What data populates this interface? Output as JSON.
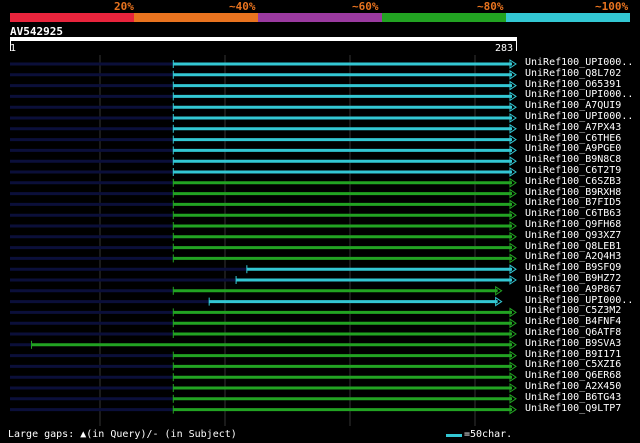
{
  "percent_bar": {
    "colors": [
      "#e8243c",
      "#e8731f",
      "#9b3aa0",
      "#22a322",
      "#33c7d3"
    ],
    "labels": [
      "20%",
      "~40%",
      "~60%",
      "~80%",
      "~100%"
    ]
  },
  "query": {
    "name": "AV542925",
    "start": "1",
    "end": "283"
  },
  "colors": {
    "high": "#33c7d3",
    "mid": "#22a322",
    "faint": "#0b0f3a"
  },
  "hits": [
    {
      "name": "UniRef100_UPI000..",
      "color": "high",
      "start": 92,
      "end": 283
    },
    {
      "name": "UniRef100_Q8L702",
      "color": "high",
      "start": 92,
      "end": 283
    },
    {
      "name": "UniRef100_O65391",
      "color": "high",
      "start": 92,
      "end": 283
    },
    {
      "name": "UniRef100_UPI000..",
      "color": "high",
      "start": 92,
      "end": 283
    },
    {
      "name": "UniRef100_A7QUI9",
      "color": "high",
      "start": 92,
      "end": 283
    },
    {
      "name": "UniRef100_UPI000..",
      "color": "high",
      "start": 92,
      "end": 283
    },
    {
      "name": "UniRef100_A7PX43",
      "color": "high",
      "start": 92,
      "end": 283
    },
    {
      "name": "UniRef100_C6THE6",
      "color": "high",
      "start": 92,
      "end": 283
    },
    {
      "name": "UniRef100_A9PGE0",
      "color": "high",
      "start": 92,
      "end": 283
    },
    {
      "name": "UniRef100_B9N8C8",
      "color": "high",
      "start": 92,
      "end": 283
    },
    {
      "name": "UniRef100_C6T2T9",
      "color": "high",
      "start": 92,
      "end": 283
    },
    {
      "name": "UniRef100_C6SZB3",
      "color": "mid",
      "start": 92,
      "end": 283
    },
    {
      "name": "UniRef100_B9RXH8",
      "color": "mid",
      "start": 92,
      "end": 283
    },
    {
      "name": "UniRef100_B7FID5",
      "color": "mid",
      "start": 92,
      "end": 283
    },
    {
      "name": "UniRef100_C6TB63",
      "color": "mid",
      "start": 92,
      "end": 283
    },
    {
      "name": "UniRef100_Q9FH68",
      "color": "mid",
      "start": 92,
      "end": 283
    },
    {
      "name": "UniRef100_Q93XZ7",
      "color": "mid",
      "start": 92,
      "end": 283
    },
    {
      "name": "UniRef100_Q8LEB1",
      "color": "mid",
      "start": 92,
      "end": 283
    },
    {
      "name": "UniRef100_A2Q4H3",
      "color": "mid",
      "start": 92,
      "end": 283
    },
    {
      "name": "UniRef100_B9SFQ9",
      "color": "high",
      "start": 133,
      "end": 283
    },
    {
      "name": "UniRef100_B9HZ72",
      "color": "high",
      "start": 127,
      "end": 283
    },
    {
      "name": "UniRef100_A9P867",
      "color": "mid",
      "start": 92,
      "end": 275
    },
    {
      "name": "UniRef100_UPI000..",
      "color": "high",
      "start": 112,
      "end": 275
    },
    {
      "name": "UniRef100_C5Z3M2",
      "color": "mid",
      "start": 92,
      "end": 283
    },
    {
      "name": "UniRef100_B4FNF4",
      "color": "mid",
      "start": 92,
      "end": 283
    },
    {
      "name": "UniRef100_Q6ATF8",
      "color": "mid",
      "start": 92,
      "end": 283
    },
    {
      "name": "UniRef100_B9SVA3",
      "color": "mid",
      "start": 13,
      "end": 283
    },
    {
      "name": "UniRef100_B9I171",
      "color": "mid",
      "start": 92,
      "end": 283
    },
    {
      "name": "UniRef100_C5XZI6",
      "color": "mid",
      "start": 92,
      "end": 283
    },
    {
      "name": "UniRef100_Q6ER68",
      "color": "mid",
      "start": 92,
      "end": 283
    },
    {
      "name": "UniRef100_A2X450",
      "color": "mid",
      "start": 92,
      "end": 283
    },
    {
      "name": "UniRef100_B6TG43",
      "color": "mid",
      "start": 92,
      "end": 283
    },
    {
      "name": "UniRef100_Q9LTP7",
      "color": "mid",
      "start": 92,
      "end": 283
    }
  ],
  "legend": {
    "text": "Large gaps: ▲(in Query)/- (in Subject)",
    "scale": "=50char."
  }
}
